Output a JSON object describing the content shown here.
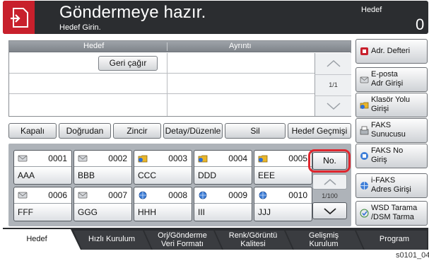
{
  "header": {
    "title": "Göndermeye hazır.",
    "subtitle": "Hedef Girin.",
    "dest_label": "Hedef",
    "dest_count": "0"
  },
  "table": {
    "col_dest": "Hedef",
    "col_detail": "Ayrıntı",
    "recall": "Geri çağır",
    "page": "1/1"
  },
  "actions": [
    "Kapalı",
    "Doğrudan",
    "Zincir",
    "Detay/Düzenle",
    "Sil",
    "Hedef Geçmişi"
  ],
  "onetouch": [
    {
      "num": "0001",
      "name": "AAA",
      "icon": "envelope-icon"
    },
    {
      "num": "0002",
      "name": "BBB",
      "icon": "envelope-icon"
    },
    {
      "num": "0003",
      "name": "CCC",
      "icon": "folder-icon"
    },
    {
      "num": "0004",
      "name": "DDD",
      "icon": "folder-icon"
    },
    {
      "num": "0005",
      "name": "EEE",
      "icon": "folder-icon"
    },
    {
      "num": "0006",
      "name": "FFF",
      "icon": "envelope-icon"
    },
    {
      "num": "0007",
      "name": "GGG",
      "icon": "envelope-icon"
    },
    {
      "num": "0008",
      "name": "HHH",
      "icon": "globe-icon"
    },
    {
      "num": "0009",
      "name": "III",
      "icon": "globe-icon"
    },
    {
      "num": "0010",
      "name": "JJJ",
      "icon": "globe-icon"
    }
  ],
  "no_button": "No.",
  "ot_page": "1/100",
  "right": [
    {
      "l1": "Adr. Defteri",
      "l2": "",
      "icon": "address-book-icon"
    },
    {
      "l1": "E-posta",
      "l2": "Adr Girişi",
      "icon": "envelope-icon"
    },
    {
      "l1": "Klasör Yolu",
      "l2": "Girişi",
      "icon": "folder-icon"
    },
    {
      "l1": "FAKS",
      "l2": "Sunucusu",
      "icon": "fax-icon"
    },
    {
      "l1": "FAKS No",
      "l2": "Giriş",
      "icon": "fax-no-icon"
    },
    {
      "l1": "i-FAKS",
      "l2": "Adres Girişi",
      "icon": "ifax-icon"
    },
    {
      "l1": "WSD Tarama",
      "l2": "/DSM Tarma",
      "icon": "wsd-scan-icon"
    }
  ],
  "tabs": [
    {
      "l1": "Hedef",
      "l2": ""
    },
    {
      "l1": "Hızlı Kurulum",
      "l2": ""
    },
    {
      "l1": "Orj/Gönderme",
      "l2": "Veri Formatı"
    },
    {
      "l1": "Renk/Görüntü",
      "l2": "Kalitesi"
    },
    {
      "l1": "Gelişmiş",
      "l2": "Kurulum"
    },
    {
      "l1": "Program",
      "l2": ""
    }
  ],
  "footer": "s0101_04",
  "colors": {
    "accent": "#c8202c",
    "header": "#2b2d30",
    "highlight": "#e0262e"
  }
}
